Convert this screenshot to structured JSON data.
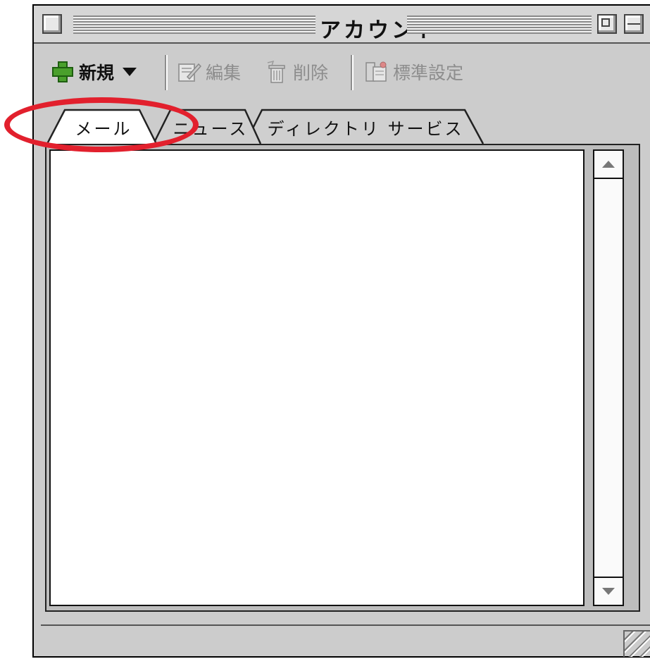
{
  "window": {
    "title": "アカウント"
  },
  "toolbar": {
    "new_label": "新規",
    "edit_label": "編集",
    "delete_label": "削除",
    "default_label": "標準設定",
    "icons": {
      "new": "plus-icon",
      "edit": "edit-icon",
      "delete": "trash-icon",
      "default": "default-setting-icon"
    },
    "accent": "#4aa02c"
  },
  "tabs": [
    {
      "label": "メール",
      "selected": true
    },
    {
      "label": "ニュース",
      "selected": false
    },
    {
      "label": "ディレクトリ サービス",
      "selected": false
    }
  ],
  "annotation": {
    "color": "#e2202d"
  }
}
